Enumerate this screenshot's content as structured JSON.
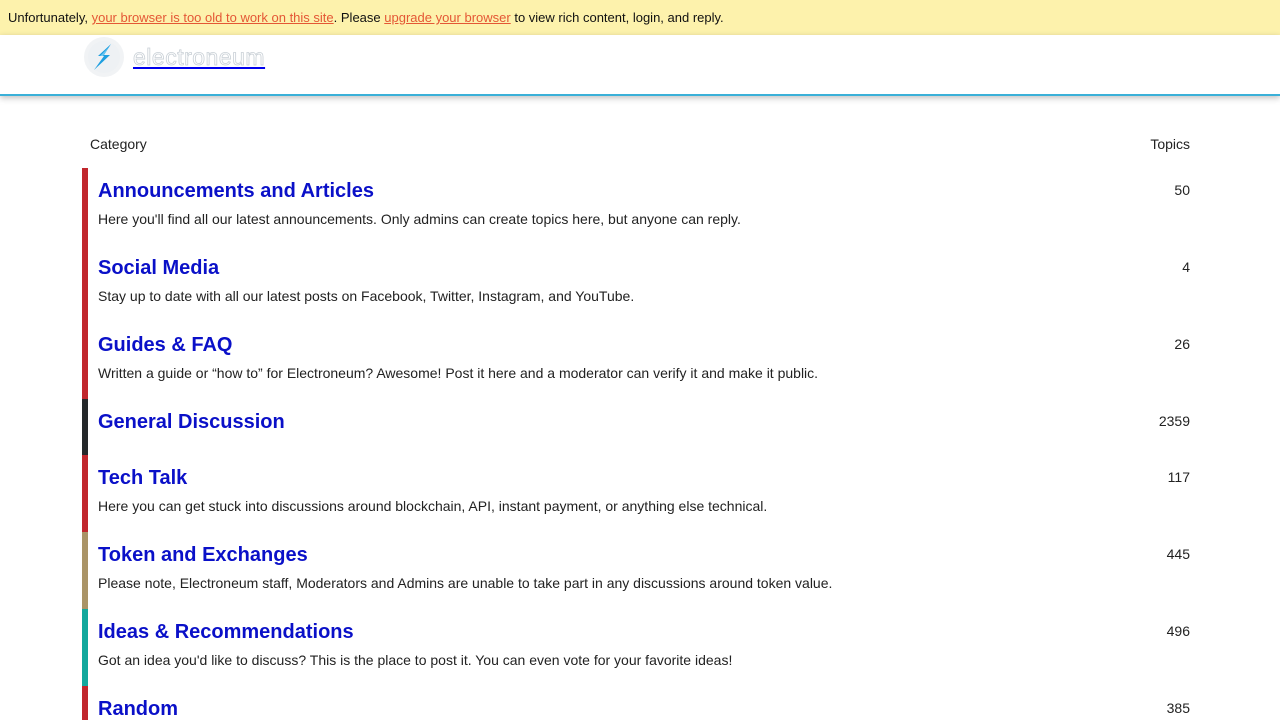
{
  "notice": {
    "prefix": "Unfortunately, ",
    "link1": "your browser is too old to work on this site",
    "middle": ". Please ",
    "link2": "upgrade your browser",
    "suffix": " to view rich content, login, and reply."
  },
  "header": {
    "logo_text": "electroneum",
    "accent_color": "#3ab0d8"
  },
  "table": {
    "col_category": "Category",
    "col_topics": "Topics"
  },
  "categories": [
    {
      "title": "Announcements and Articles",
      "topics": "50",
      "description": "Here you'll find all our latest announcements. Only admins can create topics here, but anyone can reply.",
      "color": "#c1272d"
    },
    {
      "title": "Social Media",
      "topics": "4",
      "description": "Stay up to date with all our latest posts on Facebook, Twitter, Instagram, and YouTube.",
      "color": "#c1272d"
    },
    {
      "title": "Guides & FAQ",
      "topics": "26",
      "description": "Written a guide or “how to” for Electroneum? Awesome! Post it here and a moderator can verify it and make it public.",
      "color": "#c1272d"
    },
    {
      "title": "General Discussion",
      "topics": "2359",
      "description": "",
      "color": "#25282a"
    },
    {
      "title": "Tech Talk",
      "topics": "117",
      "description": "Here you can get stuck into discussions around blockchain, API, instant payment, or anything else technical.",
      "color": "#c1272d"
    },
    {
      "title": "Token and Exchanges",
      "topics": "445",
      "description": "Please note, Electroneum staff, Moderators and Admins are unable to take part in any discussions around token value.",
      "color": "#aa9467"
    },
    {
      "title": "Ideas & Recommendations",
      "topics": "496",
      "description": "Got an idea you'd like to discuss? This is the place to post it. You can even vote for your favorite ideas!",
      "color": "#12a89d"
    },
    {
      "title": "Random",
      "topics": "385",
      "description": "",
      "color": "#c1272d"
    }
  ]
}
